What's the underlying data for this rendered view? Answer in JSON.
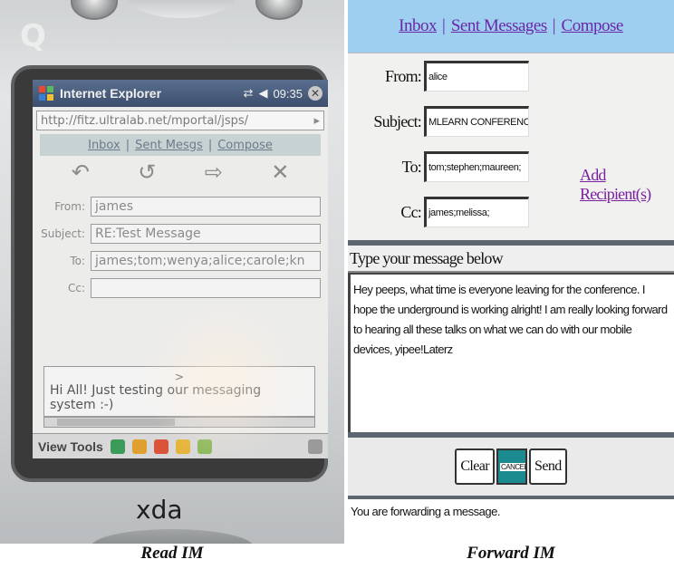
{
  "phone": {
    "browser_title": "Internet Explorer",
    "clock": "09:35",
    "address": "http://fitz.ultralab.net/mportal/jsps/",
    "nav": [
      "Inbox",
      "Sent Mesgs",
      "Compose"
    ],
    "from_label": "From:",
    "from_value": "james",
    "subject_label": "Subject:",
    "subject_value": "RE:Test Message",
    "to_label": "To:",
    "to_value": "james;tom;wenya;alice;carole;kn",
    "cc_label": "Cc:",
    "cc_value": "",
    "message_caret": ">",
    "message_text": "Hi All! Just testing our messaging system :-)",
    "toolbar_label": "View Tools",
    "brand": "xda"
  },
  "forward": {
    "nav": {
      "inbox": "Inbox",
      "sent": "Sent Messages",
      "compose": "Compose",
      "separator": "|"
    },
    "from_label": "From:",
    "from_value": "alice",
    "subject_label": "Subject:",
    "subject_value": "MLEARN CONFERENCE",
    "to_label": "To:",
    "to_value": "tom;stephen;maureen;",
    "cc_label": "Cc:",
    "cc_value": "james;melissa;",
    "add_recipients": "Add Recipient(s)",
    "message_header": "Type your message below",
    "message_body": "Hey peeps, what time is everyone leaving for the conference. I hope the underground is working alright! I am really looking forward to hearing all these talks on what we can do with our mobile devices, yipee!Laterz",
    "clear_button": "Clear",
    "cancel_button": "CANCEL",
    "send_button": "Send",
    "status_text": "You are forwarding a message."
  },
  "captions": {
    "left": "Read IM",
    "right": "Forward IM"
  }
}
